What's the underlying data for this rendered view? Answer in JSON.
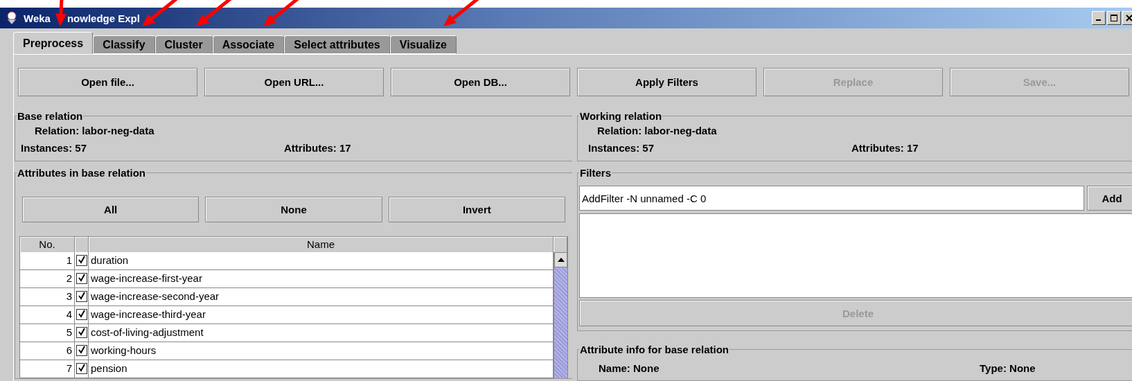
{
  "window": {
    "title_fragments": [
      "Weka",
      "nowledge Expl"
    ]
  },
  "tabs": [
    {
      "label": "Preprocess",
      "selected": true
    },
    {
      "label": "Classify",
      "selected": false
    },
    {
      "label": "Cluster",
      "selected": false
    },
    {
      "label": "Associate",
      "selected": false
    },
    {
      "label": "Select attributes",
      "selected": false
    },
    {
      "label": "Visualize",
      "selected": false
    }
  ],
  "toolbar": [
    {
      "label": "Open file...",
      "disabled": false
    },
    {
      "label": "Open URL...",
      "disabled": false
    },
    {
      "label": "Open DB...",
      "disabled": false
    },
    {
      "label": "Apply Filters",
      "disabled": false
    },
    {
      "label": "Replace",
      "disabled": true
    },
    {
      "label": "Save...",
      "disabled": true
    }
  ],
  "base_relation": {
    "title": "Base relation",
    "relation": "Relation: labor-neg-data",
    "instances": "Instances: 57",
    "attributes": "Attributes: 17"
  },
  "working_relation": {
    "title": "Working relation",
    "relation": "Relation: labor-neg-data",
    "instances": "Instances: 57",
    "attributes": "Attributes: 17"
  },
  "attributes_panel": {
    "title": "Attributes in base relation",
    "buttons": [
      "All",
      "None",
      "Invert"
    ],
    "columns": [
      "No.",
      "Name"
    ],
    "rows": [
      {
        "no": "1",
        "checked": true,
        "name": "duration"
      },
      {
        "no": "2",
        "checked": true,
        "name": "wage-increase-first-year"
      },
      {
        "no": "3",
        "checked": true,
        "name": "wage-increase-second-year"
      },
      {
        "no": "4",
        "checked": true,
        "name": "wage-increase-third-year"
      },
      {
        "no": "5",
        "checked": true,
        "name": "cost-of-living-adjustment"
      },
      {
        "no": "6",
        "checked": true,
        "name": "working-hours"
      },
      {
        "no": "7",
        "checked": true,
        "name": "pension"
      }
    ]
  },
  "filters": {
    "title": "Filters",
    "value": "AddFilter -N unnamed -C 0",
    "add": "Add",
    "delete": {
      "label": "Delete",
      "disabled": true
    }
  },
  "attribute_info": {
    "title": "Attribute info for base relation",
    "name": "Name: None",
    "type": "Type: None"
  }
}
